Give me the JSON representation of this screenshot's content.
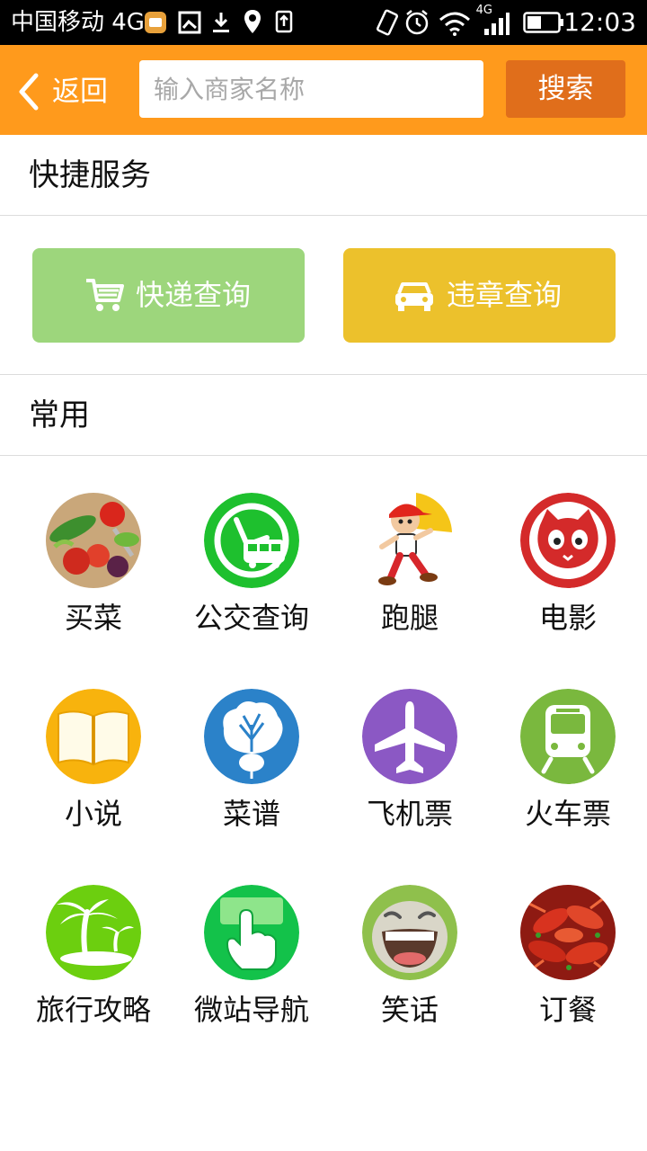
{
  "status_bar": {
    "carrier": "中国移动 4G",
    "network": "4G",
    "time": "12:03"
  },
  "header": {
    "back_label": "返回",
    "search_placeholder": "输入商家名称",
    "search_value": "",
    "search_button": "搜索"
  },
  "quick_services": {
    "title": "快捷服务",
    "buttons": [
      {
        "label": "快递查询",
        "icon": "shopping-cart-icon",
        "color": "#9dd67c"
      },
      {
        "label": "违章查询",
        "icon": "car-icon",
        "color": "#ecc12c"
      }
    ]
  },
  "common": {
    "title": "常用",
    "items": [
      {
        "label": "买菜",
        "icon": "vegetables-icon"
      },
      {
        "label": "公交查询",
        "icon": "bus-clock-icon"
      },
      {
        "label": "跑腿",
        "icon": "runner-boy-icon"
      },
      {
        "label": "电影",
        "icon": "cat-face-icon"
      },
      {
        "label": "小说",
        "icon": "open-book-icon"
      },
      {
        "label": "菜谱",
        "icon": "cabbage-icon"
      },
      {
        "label": "飞机票",
        "icon": "airplane-icon"
      },
      {
        "label": "火车票",
        "icon": "train-icon"
      },
      {
        "label": "旅行攻略",
        "icon": "palm-island-icon"
      },
      {
        "label": "微站导航",
        "icon": "finger-tap-icon"
      },
      {
        "label": "笑话",
        "icon": "laughing-face-icon"
      },
      {
        "label": "订餐",
        "icon": "crayfish-icon"
      }
    ]
  },
  "colors": {
    "header_bg": "#ff9a1c",
    "search_button_bg": "#e06e1b"
  }
}
